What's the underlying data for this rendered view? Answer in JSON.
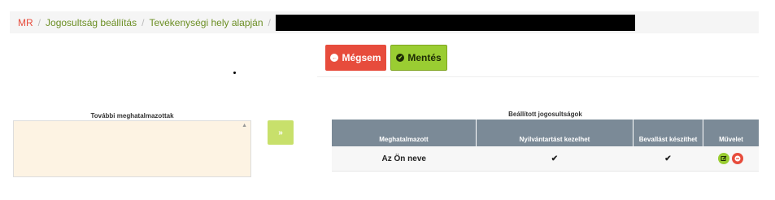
{
  "colors": {
    "accent_red": "#e74c3c",
    "accent_green": "#9acd32",
    "breadcrumb_home": "#e74c3c",
    "breadcrumb_link": "#6b8e23",
    "table_header": "#7b8a97"
  },
  "breadcrumb": {
    "items": [
      "MR",
      "Jogosultság beállítás",
      "Tevékenységi hely alapján"
    ],
    "separator": "/"
  },
  "buttons": {
    "cancel_label": "Mégsem",
    "save_label": "Mentés",
    "move_label": "»"
  },
  "left_panel": {
    "title": "További meghatalmazottak"
  },
  "right_panel": {
    "title": "Beállított jogosultságok",
    "columns": [
      "Meghatalmazott",
      "Nyilvántartást kezelhet",
      "Bevallást készíthet",
      "Művelet"
    ],
    "rows": [
      {
        "name": "Az Ön neve",
        "can_manage_registry": true,
        "can_prepare_return": true
      }
    ]
  }
}
